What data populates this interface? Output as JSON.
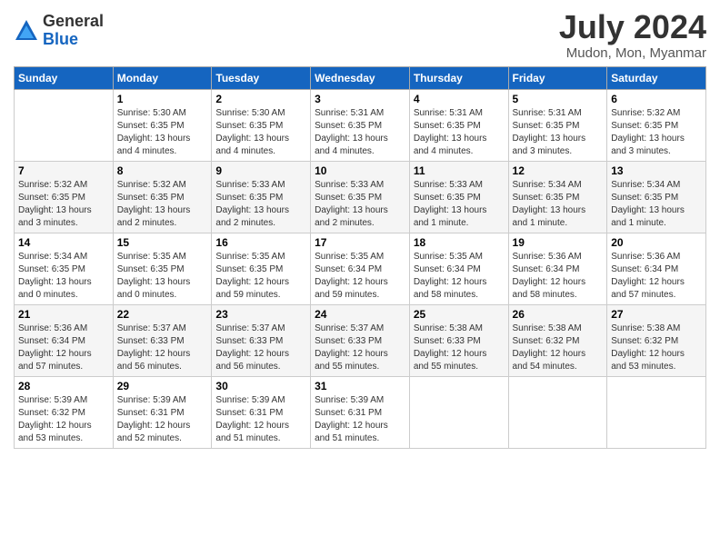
{
  "logo": {
    "general": "General",
    "blue": "Blue"
  },
  "header": {
    "title": "July 2024",
    "subtitle": "Mudon, Mon, Myanmar"
  },
  "days_of_week": [
    "Sunday",
    "Monday",
    "Tuesday",
    "Wednesday",
    "Thursday",
    "Friday",
    "Saturday"
  ],
  "weeks": [
    [
      {
        "day": "",
        "info": ""
      },
      {
        "day": "1",
        "info": "Sunrise: 5:30 AM\nSunset: 6:35 PM\nDaylight: 13 hours\nand 4 minutes."
      },
      {
        "day": "2",
        "info": "Sunrise: 5:30 AM\nSunset: 6:35 PM\nDaylight: 13 hours\nand 4 minutes."
      },
      {
        "day": "3",
        "info": "Sunrise: 5:31 AM\nSunset: 6:35 PM\nDaylight: 13 hours\nand 4 minutes."
      },
      {
        "day": "4",
        "info": "Sunrise: 5:31 AM\nSunset: 6:35 PM\nDaylight: 13 hours\nand 4 minutes."
      },
      {
        "day": "5",
        "info": "Sunrise: 5:31 AM\nSunset: 6:35 PM\nDaylight: 13 hours\nand 3 minutes."
      },
      {
        "day": "6",
        "info": "Sunrise: 5:32 AM\nSunset: 6:35 PM\nDaylight: 13 hours\nand 3 minutes."
      }
    ],
    [
      {
        "day": "7",
        "info": "Sunrise: 5:32 AM\nSunset: 6:35 PM\nDaylight: 13 hours\nand 3 minutes."
      },
      {
        "day": "8",
        "info": "Sunrise: 5:32 AM\nSunset: 6:35 PM\nDaylight: 13 hours\nand 2 minutes."
      },
      {
        "day": "9",
        "info": "Sunrise: 5:33 AM\nSunset: 6:35 PM\nDaylight: 13 hours\nand 2 minutes."
      },
      {
        "day": "10",
        "info": "Sunrise: 5:33 AM\nSunset: 6:35 PM\nDaylight: 13 hours\nand 2 minutes."
      },
      {
        "day": "11",
        "info": "Sunrise: 5:33 AM\nSunset: 6:35 PM\nDaylight: 13 hours\nand 1 minute."
      },
      {
        "day": "12",
        "info": "Sunrise: 5:34 AM\nSunset: 6:35 PM\nDaylight: 13 hours\nand 1 minute."
      },
      {
        "day": "13",
        "info": "Sunrise: 5:34 AM\nSunset: 6:35 PM\nDaylight: 13 hours\nand 1 minute."
      }
    ],
    [
      {
        "day": "14",
        "info": "Sunrise: 5:34 AM\nSunset: 6:35 PM\nDaylight: 13 hours\nand 0 minutes."
      },
      {
        "day": "15",
        "info": "Sunrise: 5:35 AM\nSunset: 6:35 PM\nDaylight: 13 hours\nand 0 minutes."
      },
      {
        "day": "16",
        "info": "Sunrise: 5:35 AM\nSunset: 6:35 PM\nDaylight: 12 hours\nand 59 minutes."
      },
      {
        "day": "17",
        "info": "Sunrise: 5:35 AM\nSunset: 6:34 PM\nDaylight: 12 hours\nand 59 minutes."
      },
      {
        "day": "18",
        "info": "Sunrise: 5:35 AM\nSunset: 6:34 PM\nDaylight: 12 hours\nand 58 minutes."
      },
      {
        "day": "19",
        "info": "Sunrise: 5:36 AM\nSunset: 6:34 PM\nDaylight: 12 hours\nand 58 minutes."
      },
      {
        "day": "20",
        "info": "Sunrise: 5:36 AM\nSunset: 6:34 PM\nDaylight: 12 hours\nand 57 minutes."
      }
    ],
    [
      {
        "day": "21",
        "info": "Sunrise: 5:36 AM\nSunset: 6:34 PM\nDaylight: 12 hours\nand 57 minutes."
      },
      {
        "day": "22",
        "info": "Sunrise: 5:37 AM\nSunset: 6:33 PM\nDaylight: 12 hours\nand 56 minutes."
      },
      {
        "day": "23",
        "info": "Sunrise: 5:37 AM\nSunset: 6:33 PM\nDaylight: 12 hours\nand 56 minutes."
      },
      {
        "day": "24",
        "info": "Sunrise: 5:37 AM\nSunset: 6:33 PM\nDaylight: 12 hours\nand 55 minutes."
      },
      {
        "day": "25",
        "info": "Sunrise: 5:38 AM\nSunset: 6:33 PM\nDaylight: 12 hours\nand 55 minutes."
      },
      {
        "day": "26",
        "info": "Sunrise: 5:38 AM\nSunset: 6:32 PM\nDaylight: 12 hours\nand 54 minutes."
      },
      {
        "day": "27",
        "info": "Sunrise: 5:38 AM\nSunset: 6:32 PM\nDaylight: 12 hours\nand 53 minutes."
      }
    ],
    [
      {
        "day": "28",
        "info": "Sunrise: 5:39 AM\nSunset: 6:32 PM\nDaylight: 12 hours\nand 53 minutes."
      },
      {
        "day": "29",
        "info": "Sunrise: 5:39 AM\nSunset: 6:31 PM\nDaylight: 12 hours\nand 52 minutes."
      },
      {
        "day": "30",
        "info": "Sunrise: 5:39 AM\nSunset: 6:31 PM\nDaylight: 12 hours\nand 51 minutes."
      },
      {
        "day": "31",
        "info": "Sunrise: 5:39 AM\nSunset: 6:31 PM\nDaylight: 12 hours\nand 51 minutes."
      },
      {
        "day": "",
        "info": ""
      },
      {
        "day": "",
        "info": ""
      },
      {
        "day": "",
        "info": ""
      }
    ]
  ]
}
